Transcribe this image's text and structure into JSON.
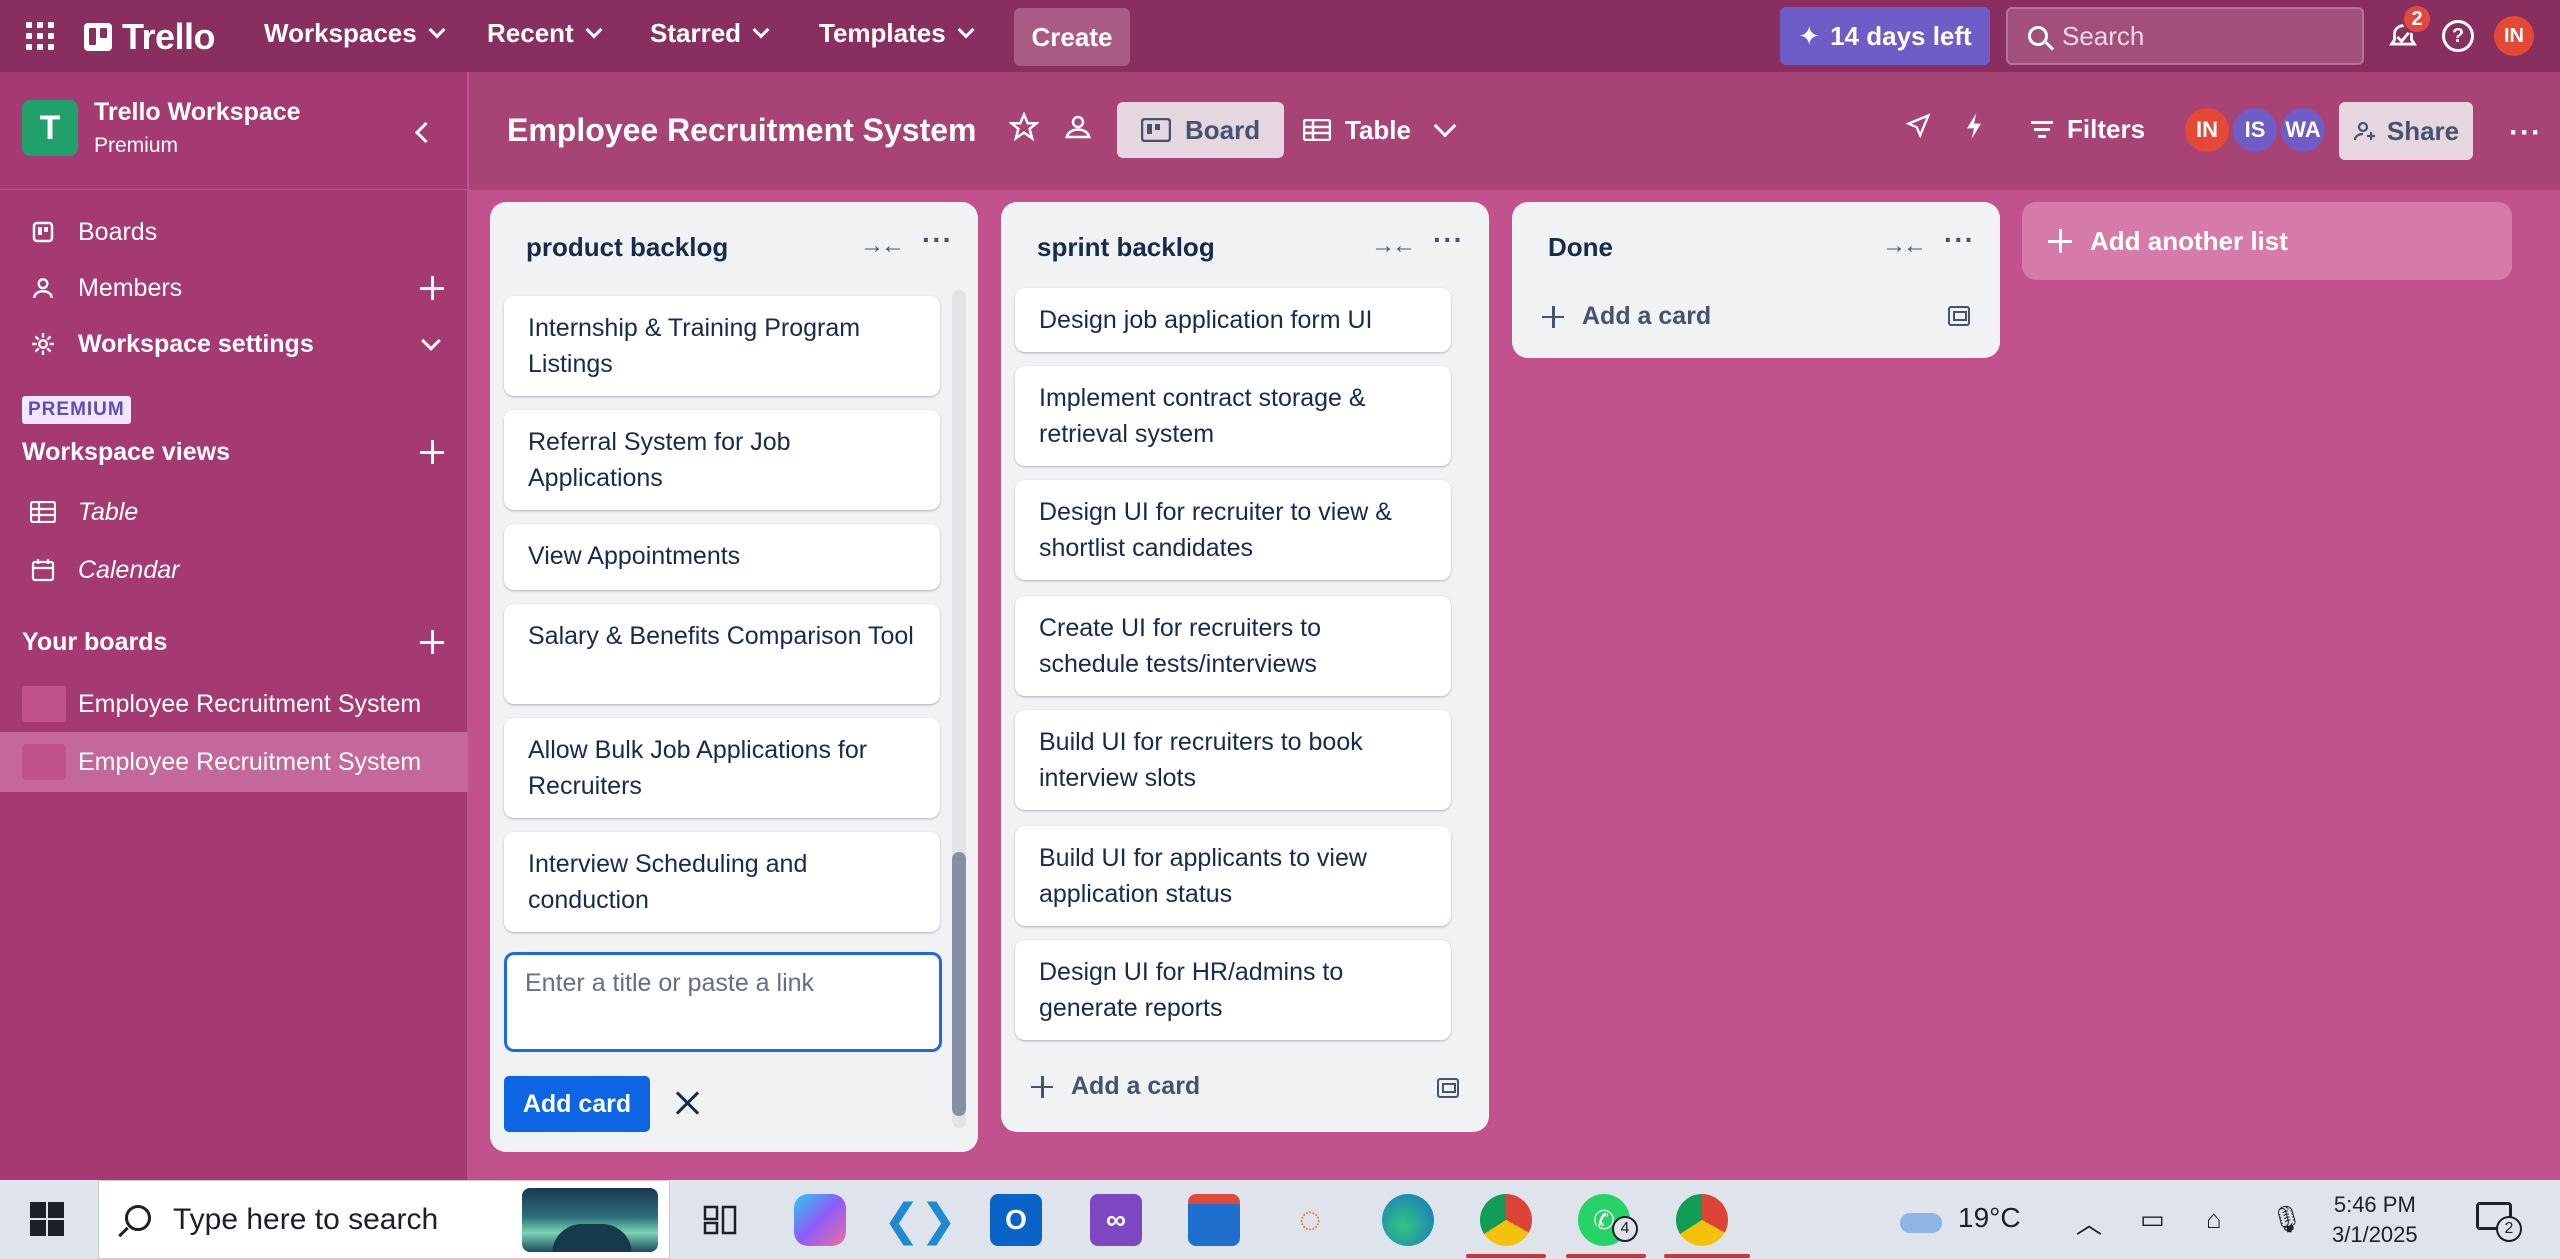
{
  "topbar": {
    "logo": "Trello",
    "nav": [
      {
        "label": "Workspaces"
      },
      {
        "label": "Recent"
      },
      {
        "label": "Starred"
      },
      {
        "label": "Templates"
      }
    ],
    "create_label": "Create",
    "trial_label": "14 days left",
    "search_placeholder": "Search",
    "notification_count": "2",
    "user_initials": "IN"
  },
  "sidebar": {
    "workspace_initial": "T",
    "workspace_name": "Trello Workspace",
    "workspace_plan": "Premium",
    "items": [
      {
        "label": "Boards",
        "icon": "board-icon"
      },
      {
        "label": "Members",
        "icon": "person-icon"
      },
      {
        "label": "Workspace settings",
        "icon": "gear-icon"
      }
    ],
    "premium_badge": "PREMIUM",
    "views_title": "Workspace views",
    "views": [
      {
        "label": "Table",
        "icon": "table-icon"
      },
      {
        "label": "Calendar",
        "icon": "calendar-icon"
      }
    ],
    "boards_title": "Your boards",
    "boards": [
      {
        "label": "Employee Recruitment System"
      },
      {
        "label": "Employee Recruitment System"
      }
    ]
  },
  "board": {
    "title": "Employee Recruitment System",
    "view_board": "Board",
    "view_table": "Table",
    "filters_label": "Filters",
    "members": [
      {
        "initials": "IN",
        "color": "#e34935"
      },
      {
        "initials": "IS",
        "color": "#6e5dc6"
      },
      {
        "initials": "WA",
        "color": "#6e5dc6"
      }
    ],
    "share_label": "Share",
    "add_list_label": "Add another list"
  },
  "lists": [
    {
      "title": "product backlog",
      "cards": [
        "Internship & Training Program Listings",
        "Referral System for Job Applications",
        "View Appointments",
        "Salary & Benefits Comparison Tool",
        "Allow Bulk Job Applications for Recruiters",
        "Interview Scheduling and conduction"
      ],
      "new_card_placeholder": "Enter a title or paste a link",
      "add_card_button": "Add card"
    },
    {
      "title": "sprint backlog",
      "cards": [
        "Design job application form UI",
        "Implement contract storage & retrieval system",
        "Design UI for recruiter to view & shortlist candidates",
        "Create UI for recruiters to schedule tests/interviews",
        "Build UI for recruiters to book interview slots",
        "Build UI for applicants to view application status",
        "Design UI for HR/admins to generate reports"
      ],
      "add_card_label": "Add a card"
    },
    {
      "title": "Done",
      "cards": [],
      "add_card_label": "Add a card"
    }
  ],
  "taskbar": {
    "search_placeholder": "Type here to search",
    "weather_temp": "19°C",
    "time": "5:46 PM",
    "date": "3/1/2025",
    "whatsapp_badge": "4",
    "notification_count": "2"
  },
  "colors": {
    "header": "#892f5f",
    "sidebar": "#a53a72",
    "board_bg": "#c2528e",
    "list_bg": "#f1f2f4",
    "primary_button": "#0c66e4",
    "trial_button": "#6e5dc6"
  }
}
